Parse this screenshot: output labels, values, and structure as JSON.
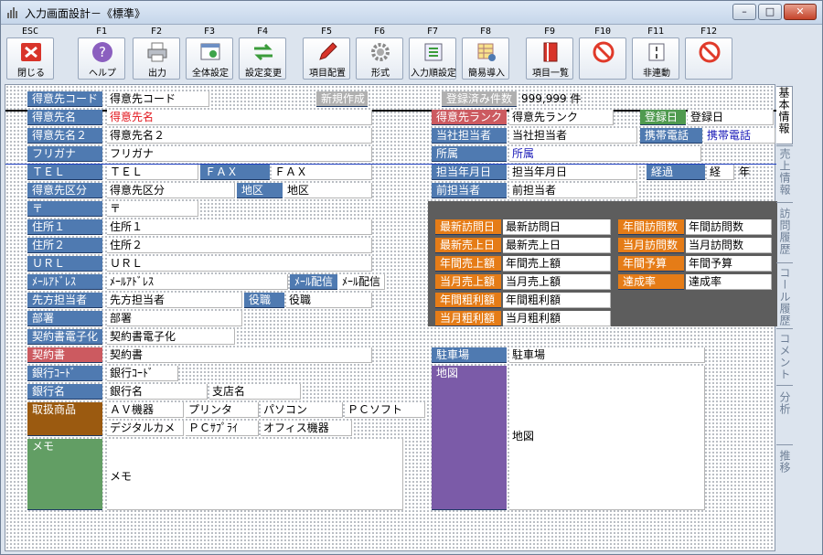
{
  "window": {
    "title": "入力画面設計－《標準》",
    "controls": {
      "minimize": "–",
      "maximize": "□",
      "close": "✕"
    }
  },
  "toolbar": [
    {
      "key": "ESC",
      "label": "閉じる",
      "icon": "close-x-icon"
    },
    {
      "key": "F1",
      "label": "ヘルプ",
      "icon": "help-icon"
    },
    {
      "key": "F2",
      "label": "出力",
      "icon": "printer-icon"
    },
    {
      "key": "F3",
      "label": "全体設定",
      "icon": "settings-window-icon"
    },
    {
      "key": "F4",
      "label": "設定変更",
      "icon": "swap-arrows-icon"
    },
    {
      "key": "F5",
      "label": "項目配置",
      "icon": "pencil-icon"
    },
    {
      "key": "F6",
      "label": "形式",
      "icon": "gear-icon"
    },
    {
      "key": "F7",
      "label": "入力順設定",
      "icon": "input-order-icon"
    },
    {
      "key": "F8",
      "label": "簡易導入",
      "icon": "table-import-icon"
    },
    {
      "key": "F9",
      "label": "項目一覧",
      "icon": "red-book-icon"
    },
    {
      "key": "F10",
      "label": "",
      "icon": "no-entry-icon"
    },
    {
      "key": "F11",
      "label": "非連動",
      "icon": "unlink-icon"
    },
    {
      "key": "F12",
      "label": "",
      "icon": "no-entry-icon"
    }
  ],
  "colors": {
    "label_blue": "#4f7ab1",
    "label_orange": "#e57c17",
    "label_red": "#cc5a60",
    "value_red": "#e2161c",
    "value_blue": "#1a1ab8"
  },
  "form": {
    "code": {
      "label": "得意先コード",
      "value": "得意先コード",
      "new_button": "新規作成"
    },
    "reg_count": {
      "label": "登録済み件数",
      "value": "999,999 件"
    },
    "name": {
      "label": "得意先名",
      "value": "得意先名"
    },
    "name2": {
      "label": "得意先名２",
      "value": "得意先名２"
    },
    "kana": {
      "label": "フリガナ",
      "value": "フリガナ"
    },
    "tel": {
      "label": "ＴＥＬ",
      "value": "ＴＥＬ"
    },
    "fax": {
      "label": "ＦＡＸ",
      "value": "ＦＡＸ"
    },
    "category": {
      "label": "得意先区分",
      "value": "得意先区分"
    },
    "area": {
      "label": "地区",
      "value": "地区"
    },
    "zip": {
      "label": "〒",
      "value": "〒"
    },
    "addr1": {
      "label": "住所１",
      "value": "住所１"
    },
    "addr2": {
      "label": "住所２",
      "value": "住所２"
    },
    "url": {
      "label": "ＵＲＬ",
      "value": "ＵＲＬ"
    },
    "email": {
      "label": "ﾒｰﾙｱﾄﾞﾚｽ",
      "value": "ﾒｰﾙｱﾄﾞﾚｽ"
    },
    "mail_delivery": {
      "label": "ﾒｰﾙ配信",
      "value": "ﾒｰﾙ配信"
    },
    "contact": {
      "label": "先方担当者",
      "value": "先方担当者"
    },
    "position": {
      "label": "役職",
      "value": "役職"
    },
    "dept": {
      "label": "部署",
      "value": "部署"
    },
    "contract_doc": {
      "label": "契約書電子化",
      "value": "契約書電子化"
    },
    "contract": {
      "label": "契約書",
      "value": "契約書"
    },
    "bank_code": {
      "label": "銀行ｺｰﾄﾞ",
      "value": "銀行ｺｰﾄﾞ"
    },
    "bank_name": {
      "label": "銀行名",
      "value": "銀行名"
    },
    "branch": {
      "value": "支店名"
    },
    "products": {
      "label": "取扱商品",
      "items": [
        "ＡＶ機器",
        "プリンタ",
        "パソコン",
        "ＰＣソフト",
        "デジタルカメ",
        "ＰＣｻﾌﾟﾗｲ",
        "オフィス機器"
      ]
    },
    "memo": {
      "label": "メモ",
      "value": "メモ"
    },
    "rank": {
      "label": "得意先ランク",
      "value": "得意先ランク"
    },
    "reg_date": {
      "label": "登録日",
      "value": "登録日"
    },
    "staff": {
      "label": "当社担当者",
      "value": "当社担当者"
    },
    "mobile": {
      "label": "携帯電話",
      "value": "携帯電話"
    },
    "affiliation": {
      "label": "所属",
      "value": "所属"
    },
    "staff_date": {
      "label": "担当年月日",
      "value": "担当年月日"
    },
    "elapsed": {
      "label": "経過",
      "value": "経",
      "unit": "年"
    },
    "prev_staff": {
      "label": "前担当者",
      "value": "前担当者"
    },
    "stats": [
      {
        "label": "最新訪問日",
        "value": "最新訪問日"
      },
      {
        "label": "最新売上日",
        "value": "最新売上日"
      },
      {
        "label": "年間売上額",
        "value": "年間売上額"
      },
      {
        "label": "当月売上額",
        "value": "当月売上額"
      },
      {
        "label": "年間粗利額",
        "value": "年間粗利額"
      },
      {
        "label": "当月粗利額",
        "value": "当月粗利額"
      }
    ],
    "stats2": [
      {
        "label": "年間訪問数",
        "value": "年間訪問数"
      },
      {
        "label": "当月訪問数",
        "value": "当月訪問数"
      },
      {
        "label": "年間予算",
        "value": "年間予算"
      },
      {
        "label": "達成率",
        "value": "達成率"
      }
    ],
    "parking": {
      "label": "駐車場",
      "value": "駐車場"
    },
    "map": {
      "label": "地図",
      "value": "地図"
    }
  },
  "side_tabs": [
    "基本情報",
    "売上情報",
    "訪問履歴",
    "コール履歴",
    "コメント",
    "分析",
    "推移"
  ]
}
